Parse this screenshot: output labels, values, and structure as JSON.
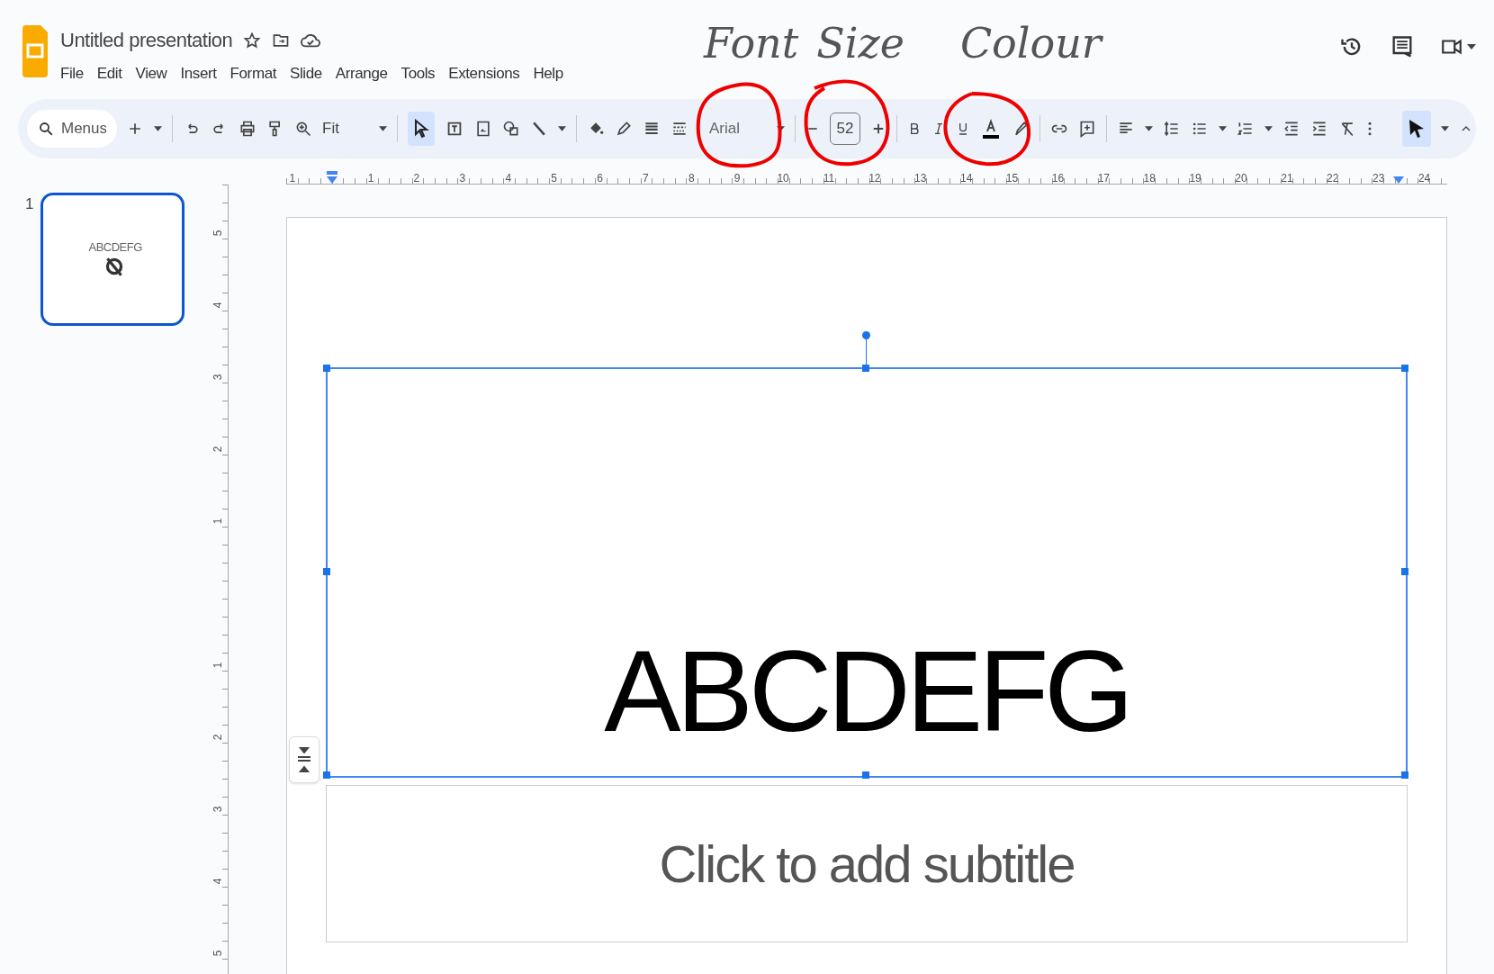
{
  "document": {
    "title": "Untitled presentation"
  },
  "menu": [
    "File",
    "Edit",
    "View",
    "Insert",
    "Format",
    "Slide",
    "Arrange",
    "Tools",
    "Extensions",
    "Help"
  ],
  "toolbar": {
    "search": {
      "placeholder": "Menus"
    },
    "zoom": "Fit",
    "font": "Arial",
    "font_size": "52",
    "select_tool": {
      "selected": true
    },
    "pointer_mode": {
      "selected": true
    }
  },
  "ruler": {
    "lead": "1",
    "labels": [
      "1",
      "2",
      "3",
      "4",
      "5",
      "6",
      "7",
      "8",
      "9",
      "10",
      "11",
      "12",
      "13",
      "14",
      "15",
      "16",
      "17",
      "18",
      "19",
      "20",
      "21",
      "22",
      "23",
      "24"
    ]
  },
  "vertical_ruler": {
    "above": [
      "5",
      "4",
      "3",
      "2",
      "1"
    ],
    "below": [
      "1",
      "2",
      "3",
      "4",
      "5"
    ]
  },
  "filmstrip": [
    {
      "number": "1",
      "thumbnail_text": "ABCDEFG",
      "selected": true
    }
  ],
  "slide": {
    "title": "ABCDEFG",
    "title_selected": true,
    "subtitle_placeholder": "Click to add subtitle"
  },
  "annotations": [
    {
      "kind": "note",
      "text": "Font"
    },
    {
      "kind": "note",
      "text": "Size"
    },
    {
      "kind": "note",
      "text": "Colour"
    }
  ]
}
